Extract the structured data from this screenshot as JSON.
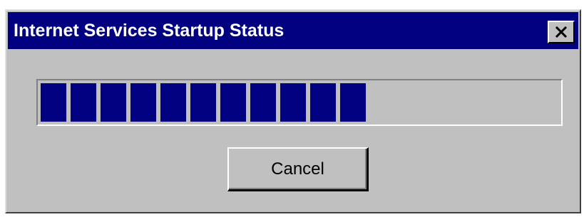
{
  "window": {
    "title": "Internet Services Startup Status",
    "close_label": "Close"
  },
  "progress": {
    "filled_blocks": 11,
    "total_blocks": 17,
    "fraction": 0.65,
    "bar_color": "#000080",
    "track_color": "#c0c0c0"
  },
  "buttons": {
    "cancel_label": "Cancel"
  },
  "theme": {
    "titlebar_color": "#000080",
    "face_color": "#c0c0c0"
  }
}
